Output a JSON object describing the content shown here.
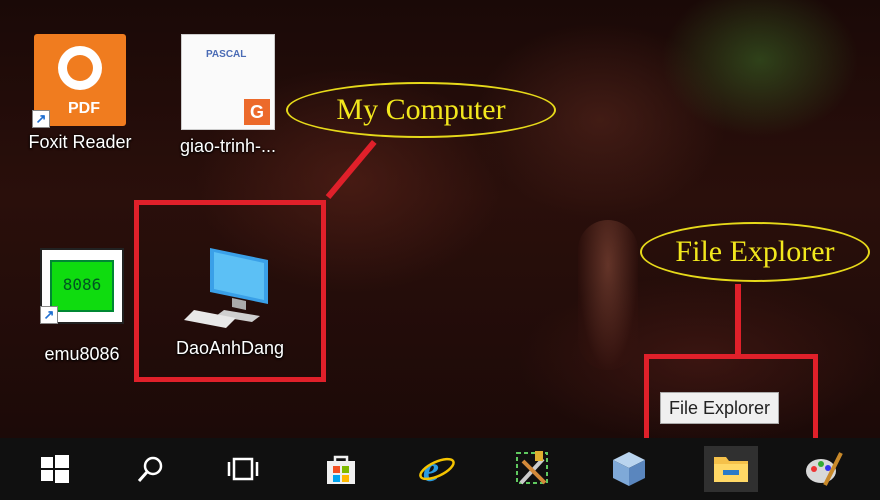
{
  "desktop": {
    "icons": [
      {
        "label": "Foxit Reader",
        "icon": "foxit-pdf-icon"
      },
      {
        "label": "giao-trinh-...",
        "icon": "pascal-document-icon",
        "doc_text": "PASCAL",
        "badge": "G"
      },
      {
        "label": "emu8086",
        "icon": "emu8086-chip-icon",
        "chip_text": "8086"
      },
      {
        "label": "DaoAnhDang",
        "icon": "computer-monitor-icon"
      }
    ],
    "foxit_pdf_text": "PDF"
  },
  "annotations": {
    "my_computer": "My Computer",
    "file_explorer": "File Explorer",
    "callout_color": "#f2e71d",
    "box_color": "#e0202a"
  },
  "tooltip": {
    "text": "File Explorer"
  },
  "taskbar": {
    "items": [
      "windows-start-icon",
      "search-icon",
      "task-view-icon",
      "store-icon",
      "internet-explorer-icon",
      "tools-icon",
      "cube-app-icon",
      "file-explorer-icon",
      "paint-icon"
    ]
  }
}
